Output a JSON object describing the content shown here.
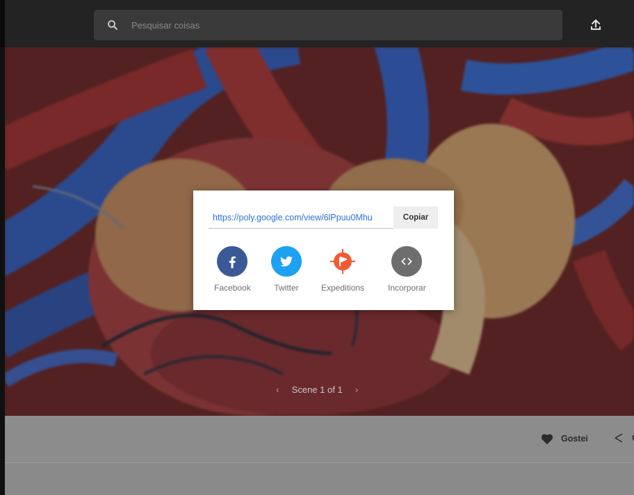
{
  "search": {
    "placeholder": "Pesquisar coisas"
  },
  "icons": {
    "search": "search-icon",
    "upload": "upload-icon",
    "facebook": "facebook-icon",
    "twitter": "twitter-icon",
    "expeditions": "expeditions-icon",
    "embed": "embed-code-icon",
    "like": "heart-icon",
    "share": "share-icon"
  },
  "dialog": {
    "url": "https://poly.google.com/view/6lPpuu0Mhu",
    "copy_label": "Copiar",
    "shares": [
      {
        "label": "Facebook",
        "color": "#3b5998"
      },
      {
        "label": "Twitter",
        "color": "#1da1f2"
      },
      {
        "label": "Expeditions",
        "color": "#f25b35"
      },
      {
        "label": "Incorporar",
        "color": "#6e6e6e"
      }
    ]
  },
  "viewer": {
    "scene_label": "Scene 1 of 1",
    "prev": "‹",
    "next": "›"
  },
  "actions": {
    "like_label": "Gostei",
    "share_label": "C"
  }
}
